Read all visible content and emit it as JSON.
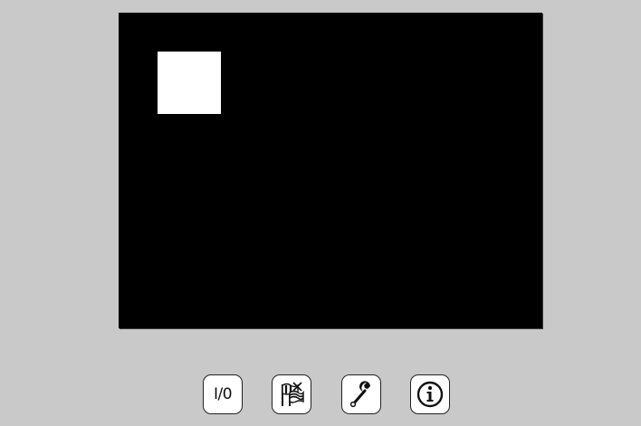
{
  "screen": {
    "background_color": "#000000",
    "marker_color": "#ffffff"
  },
  "toolbar": {
    "buttons": [
      {
        "id": "power",
        "label": "I/0",
        "icon": "power-toggle"
      },
      {
        "id": "language",
        "label": "",
        "icon": "flags-icon"
      },
      {
        "id": "settings",
        "label": "",
        "icon": "wrench-icon"
      },
      {
        "id": "info",
        "label": "",
        "icon": "info-icon"
      }
    ]
  },
  "colors": {
    "page_background": "#c9c9c9",
    "button_background": "#ffffff",
    "button_border": "#222222"
  }
}
